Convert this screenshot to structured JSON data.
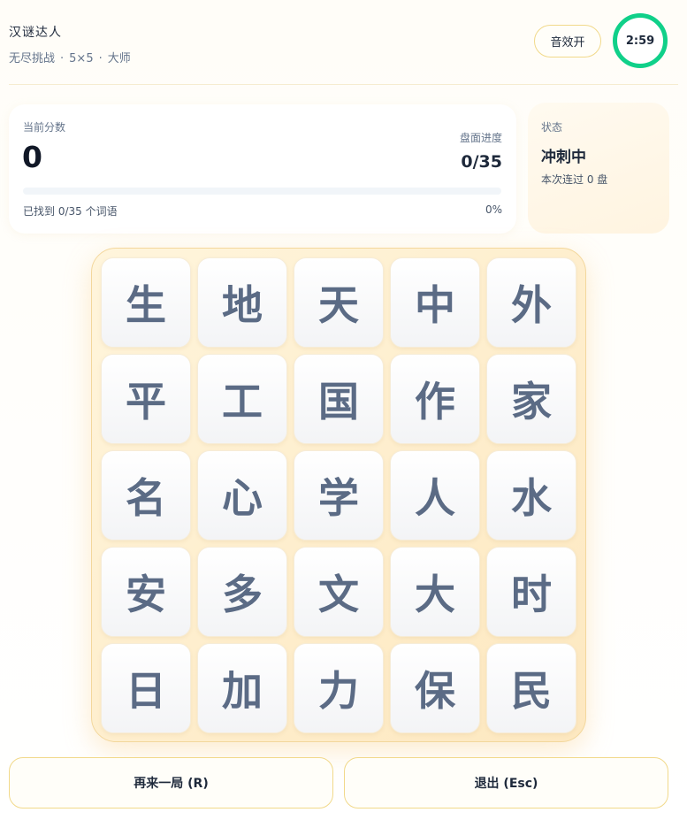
{
  "header": {
    "title": "汉谜达人",
    "mode": "无尽挑战",
    "size": "5×5",
    "difficulty": "大师",
    "separator": "·",
    "sound_label": "音效开",
    "timer": "2:59"
  },
  "score": {
    "label": "当前分数",
    "value": "0",
    "progress_label": "盘面进度",
    "progress_value": "0/35",
    "progress_fraction": 0,
    "found_text": "已找到 0/35 个词语",
    "percent_text": "0%"
  },
  "status": {
    "label": "状态",
    "value": "冲刺中",
    "sub": "本次连过 0 盘"
  },
  "board": {
    "tiles": [
      "生",
      "地",
      "天",
      "中",
      "外",
      "平",
      "工",
      "国",
      "作",
      "家",
      "名",
      "心",
      "学",
      "人",
      "水",
      "安",
      "多",
      "文",
      "大",
      "时",
      "日",
      "加",
      "力",
      "保",
      "民"
    ]
  },
  "actions": {
    "restart_label": "再来一局 (R)",
    "exit_label": "退出 (Esc)"
  },
  "colors": {
    "timer_ring": "#10d089",
    "tile_text": "#5b6b85",
    "board_border": "#f3d79c"
  }
}
